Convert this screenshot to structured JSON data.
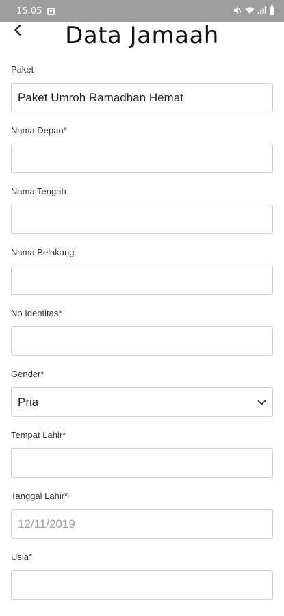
{
  "status_bar": {
    "time": "15:05"
  },
  "header": {
    "title": "Data Jamaah"
  },
  "form": {
    "paket": {
      "label": "Paket",
      "value": "Paket Umroh Ramadhan Hemat"
    },
    "nama_depan": {
      "label": "Nama Depan*",
      "value": ""
    },
    "nama_tengah": {
      "label": "Nama Tengah",
      "value": ""
    },
    "nama_belakang": {
      "label": "Nama Belakang",
      "value": ""
    },
    "no_identitas": {
      "label": "No Identitas*",
      "value": ""
    },
    "gender": {
      "label": "Gender*",
      "value": "Pria"
    },
    "tempat_lahir": {
      "label": "Tempat Lahir*",
      "value": ""
    },
    "tanggal_lahir": {
      "label": "Tanggal Lahir*",
      "placeholder": "12/11/2019"
    },
    "usia": {
      "label": "Usia*",
      "value": ""
    }
  }
}
